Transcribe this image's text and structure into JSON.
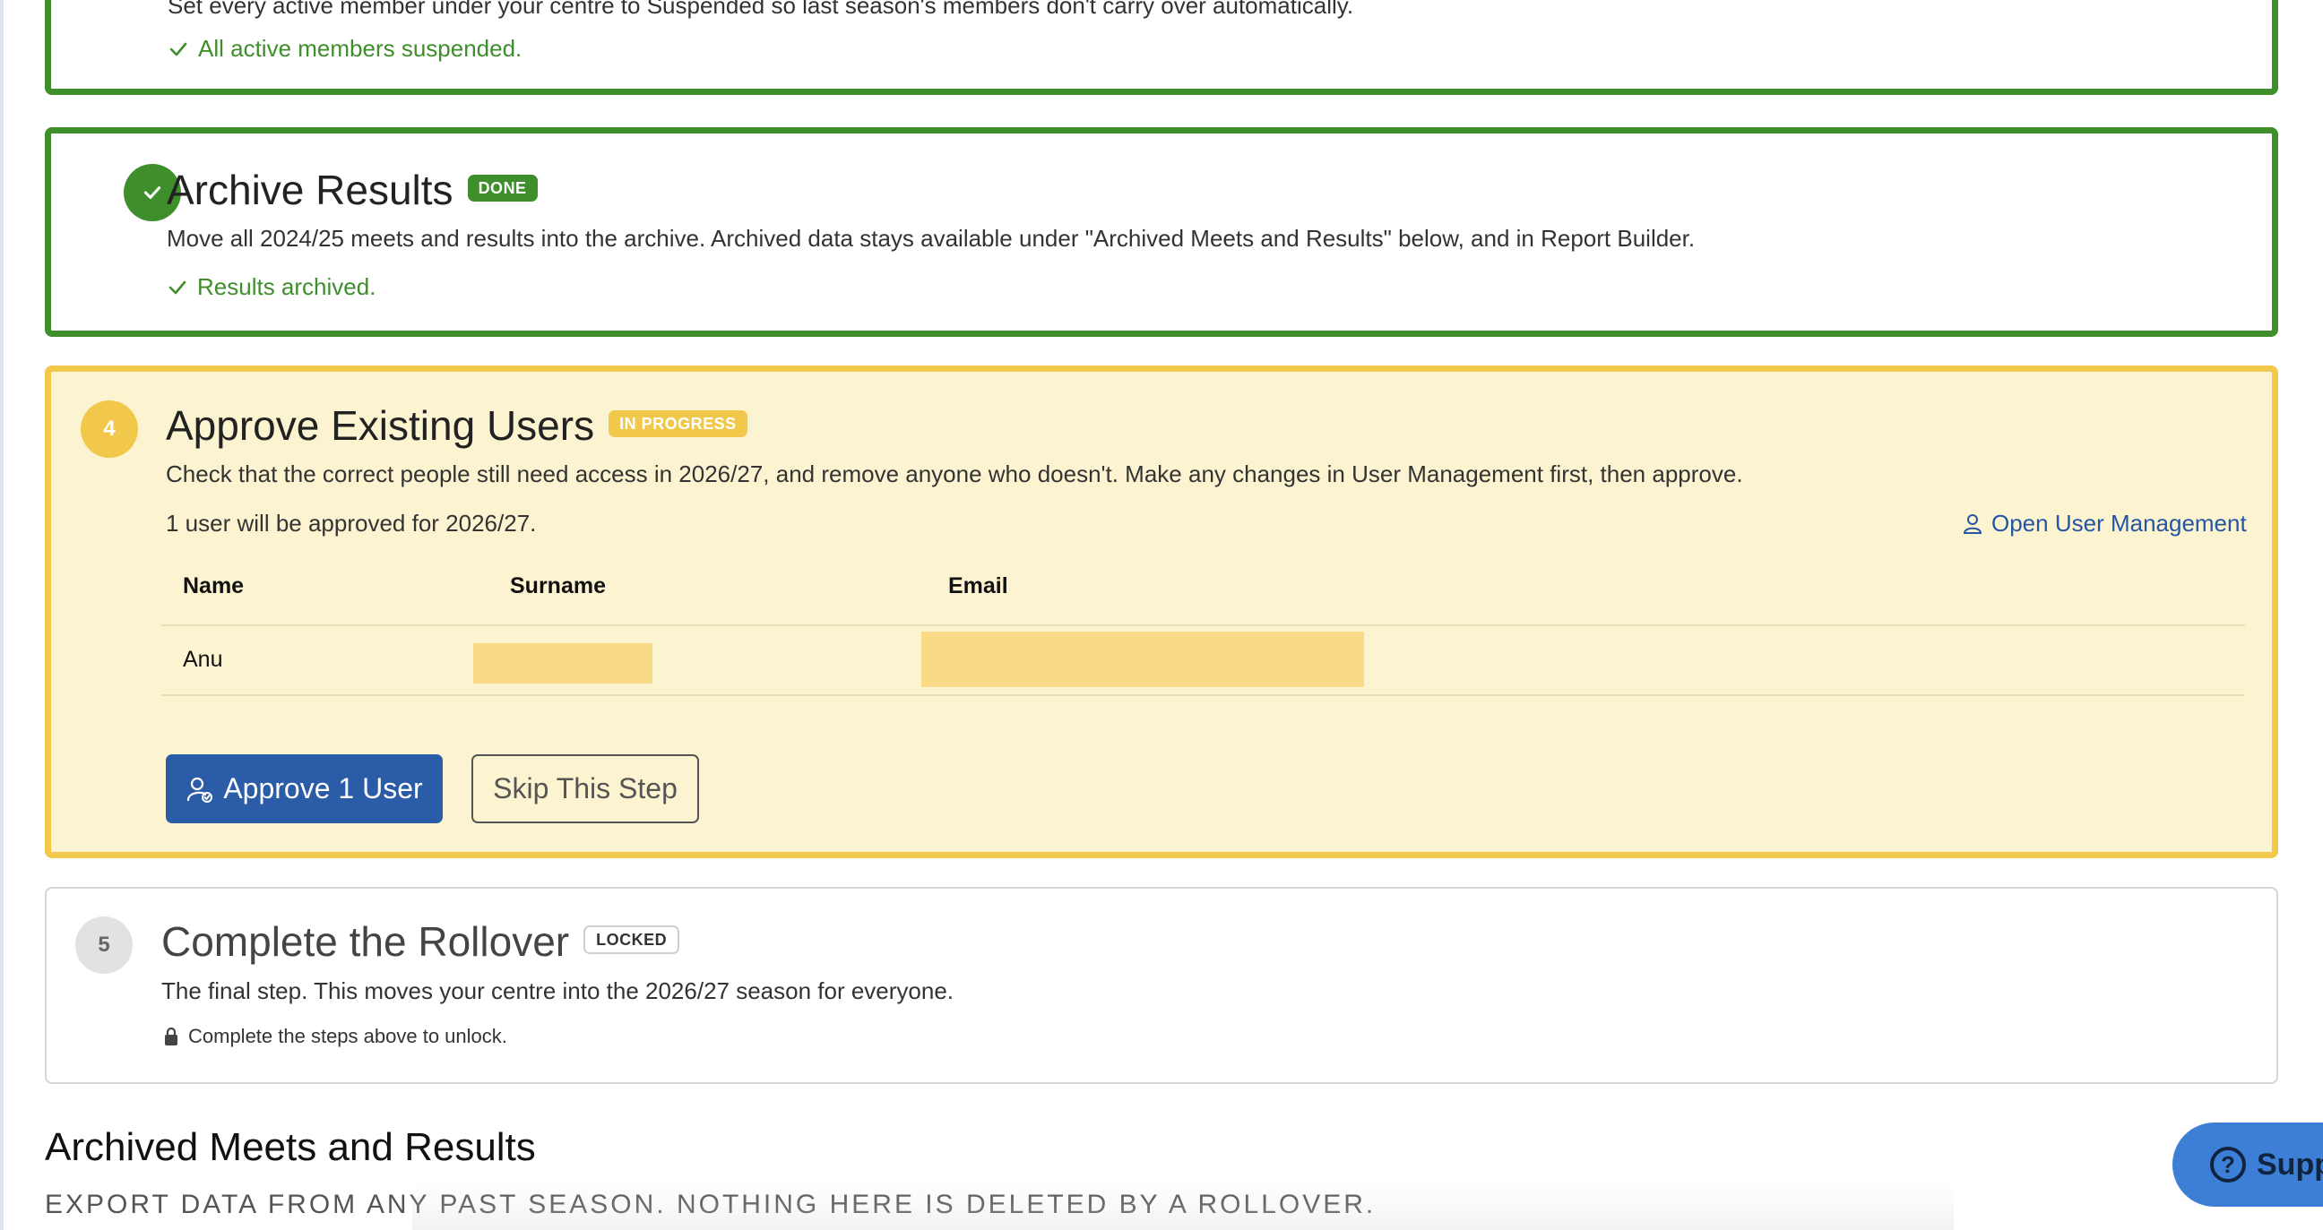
{
  "step_prev": {
    "cut_text": "Set every active member under your centre to Suspended so last season's members don't carry over automatically.",
    "status": "All active members suspended."
  },
  "step_archive": {
    "title": "Archive Results",
    "badge": "DONE",
    "description": "Move all 2024/25 meets and results into the archive. Archived data stays available under \"Archived Meets and Results\" below, and in Report Builder.",
    "status": "Results archived."
  },
  "step_approve": {
    "number": "4",
    "title": "Approve Existing Users",
    "badge": "IN PROGRESS",
    "description": "Check that the correct people still need access in 2026/27, and remove anyone who doesn't. Make any changes in User Management first, then approve.",
    "summary": "1 user will be approved for 2026/27.",
    "open_link": "Open User Management",
    "table": {
      "headers": [
        "Name",
        "Surname",
        "Email"
      ],
      "rows": [
        {
          "name": "Anu"
        }
      ]
    },
    "approve_button": "Approve 1 User",
    "skip_button": "Skip This Step"
  },
  "step_complete": {
    "number": "5",
    "title": "Complete the Rollover",
    "badge": "LOCKED",
    "description": "The final step. This moves your centre into the 2026/27 season for everyone.",
    "lock_note": "Complete the steps above to unlock."
  },
  "archived_section": {
    "title": "Archived Meets and Results",
    "subtitle": "Export data from any past season. Nothing here is deleted by a rollover."
  },
  "support": {
    "label": "Supp"
  },
  "colors": {
    "done_green": "#3e8e2c",
    "progress_yellow": "#f2c84b",
    "progress_bg": "#fcf4d1",
    "primary_blue": "#2b5ca8",
    "link_blue": "#2456a4",
    "support_blue": "#3d7fd6"
  }
}
